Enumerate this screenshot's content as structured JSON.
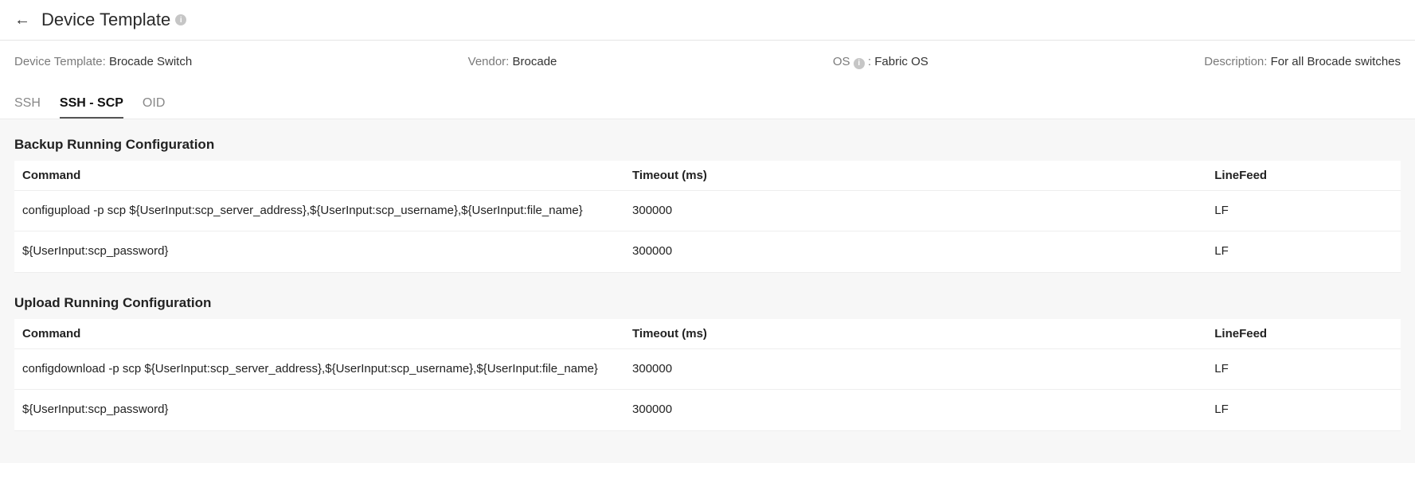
{
  "header": {
    "title": "Device Template"
  },
  "meta": {
    "template_label": "Device Template:",
    "template_value": "Brocade Switch",
    "vendor_label": "Vendor:",
    "vendor_value": "Brocade",
    "os_label": "OS",
    "os_suffix": ":",
    "os_value": "Fabric OS",
    "description_label": "Description:",
    "description_value": "For all Brocade switches"
  },
  "tabs": {
    "ssh": "SSH",
    "ssh_scp": "SSH - SCP",
    "oid": "OID"
  },
  "sections": {
    "backup_title": "Backup Running Configuration",
    "upload_title": "Upload Running Configuration"
  },
  "columns": {
    "command": "Command",
    "timeout": "Timeout (ms)",
    "linefeed": "LineFeed"
  },
  "backup_rows": [
    {
      "command": "configupload -p scp ${UserInput:scp_server_address},${UserInput:scp_username},${UserInput:file_name}",
      "timeout": "300000",
      "linefeed": "LF"
    },
    {
      "command": "${UserInput:scp_password}",
      "timeout": "300000",
      "linefeed": "LF"
    }
  ],
  "upload_rows": [
    {
      "command": "configdownload -p scp ${UserInput:scp_server_address},${UserInput:scp_username},${UserInput:file_name}",
      "timeout": "300000",
      "linefeed": "LF"
    },
    {
      "command": "${UserInput:scp_password}",
      "timeout": "300000",
      "linefeed": "LF"
    }
  ]
}
